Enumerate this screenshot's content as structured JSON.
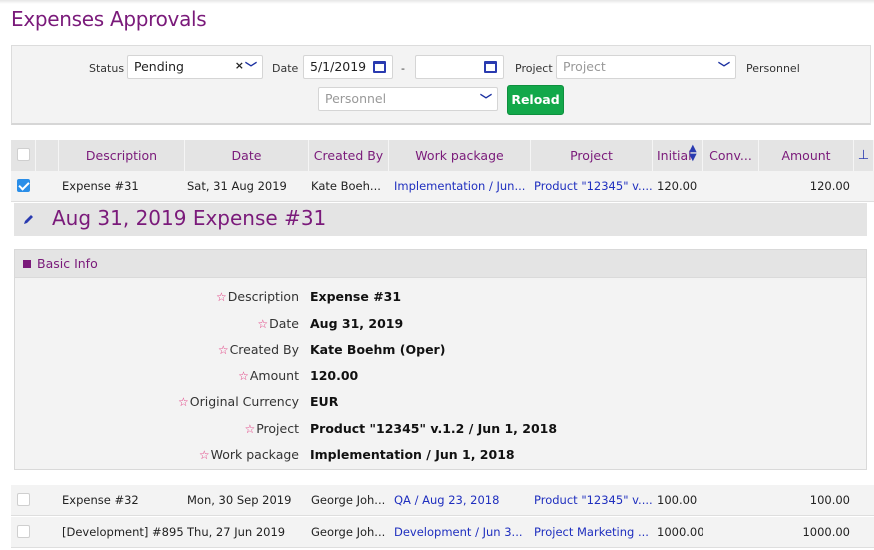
{
  "page": {
    "title": "Expenses Approvals"
  },
  "filters": {
    "status_label": "Status",
    "status_value": "Pending",
    "date_label": "Date",
    "date_from": "5/1/2019",
    "date_separator": "-",
    "date_to": "",
    "project_label": "Project",
    "project_placeholder": "Project",
    "personnel_label": "Personnel",
    "personnel_placeholder": "Personnel",
    "reload_label": "Reload"
  },
  "grid": {
    "columns": [
      "Description",
      "Date",
      "Created By",
      "Work package",
      "Project",
      "Initial",
      "Conv...",
      "Amount"
    ],
    "rows": [
      {
        "checked": true,
        "description": "Expense #31",
        "date": "Sat, 31 Aug 2019",
        "created_by": "Kate Boeh...",
        "work_package": "Implementation / Jun...",
        "project": "Product \"12345\" v....",
        "initial": "120.00",
        "converted": "",
        "amount": "120.00"
      },
      {
        "checked": false,
        "description": "Expense #32",
        "date": "Mon, 30 Sep 2019",
        "created_by": "George Joh...",
        "work_package": "QA / Aug 23, 2018",
        "project": "Product \"12345\" v....",
        "initial": "100.00",
        "converted": "",
        "amount": "100.00"
      },
      {
        "checked": false,
        "description": "[Development] #895",
        "date": "Thu, 27 Jun 2019",
        "created_by": "George Joh...",
        "work_package": "Development / Jun 3...",
        "project": "Project Marketing ...",
        "initial": "1000.00",
        "converted": "",
        "amount": "1000.00"
      }
    ]
  },
  "detail": {
    "title": "Aug 31, 2019 Expense #31",
    "section_title": "Basic Info",
    "fields": [
      {
        "label": "Description",
        "value": "Expense #31"
      },
      {
        "label": "Date",
        "value": "Aug 31, 2019"
      },
      {
        "label": "Created By",
        "value": "Kate Boehm (Oper)"
      },
      {
        "label": "Amount",
        "value": "120.00"
      },
      {
        "label": "Original Currency",
        "value": "EUR"
      },
      {
        "label": "Project",
        "value": "Product \"12345\" v.1.2 / Jun 1, 2018"
      },
      {
        "label": "Work package",
        "value": "Implementation / Jun 1, 2018"
      }
    ]
  },
  "icons": {
    "star": "☆",
    "pin": "pin-icon",
    "sort": "sort-icon",
    "edit": "pencil-icon"
  },
  "colors": {
    "accent": "#7a1a7a",
    "link": "#1f2fbf",
    "reload": "#12a84a",
    "star": "#e0307a",
    "check": "#2a8ee8"
  }
}
